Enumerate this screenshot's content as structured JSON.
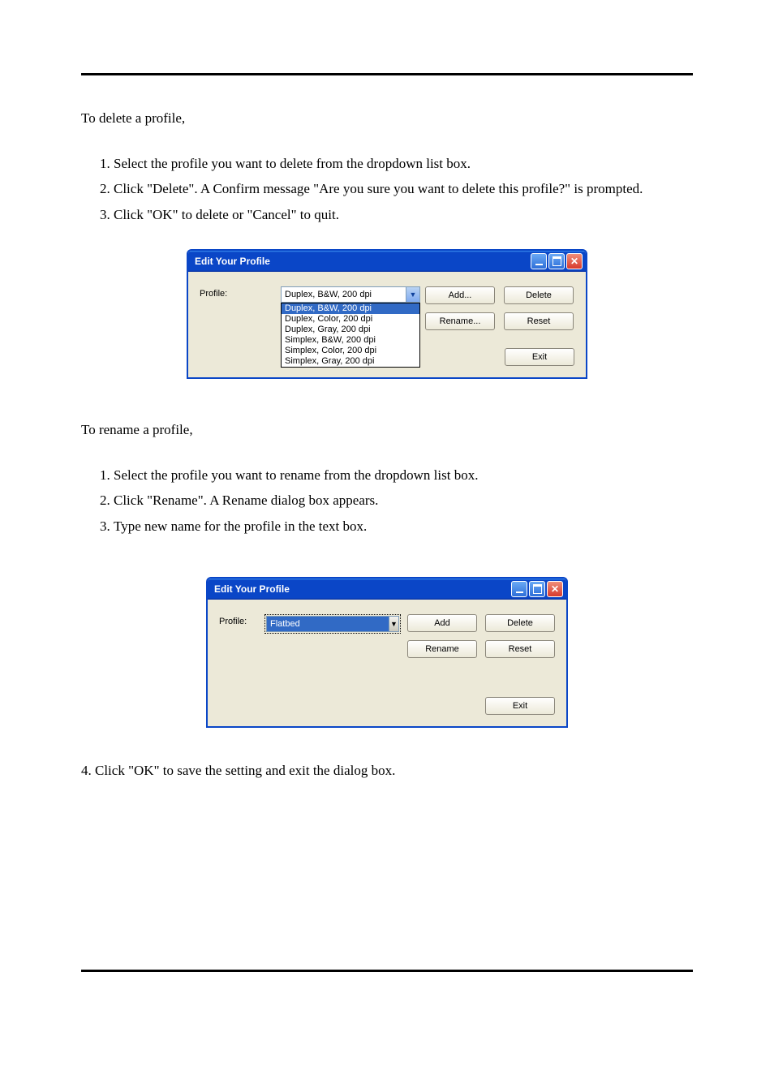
{
  "instructions": {
    "to_delete_a_profile": "To delete a profile,",
    "steps_delete": [
      "Select the profile you want to delete from the dropdown list box.",
      "Click \"Delete\". A Confirm message \"Are you sure you want to delete this profile?\" is prompted.",
      "Click \"OK\" to delete or \"Cancel\" to quit."
    ],
    "to_rename_a_profile": "To rename a profile,",
    "steps_rename": [
      "Select the profile you want to rename from the dropdown list box.",
      "Click \"Rename\". A Rename dialog box appears.",
      "Type new name for the profile in the text box."
    ],
    "click_ok_rename": "4. Click \"OK\" to save the setting and exit the dialog box."
  },
  "window": {
    "title": "Edit Your Profile",
    "profile_label": "Profile:",
    "buttons": {
      "add": "Add...",
      "delete": "Delete",
      "rename": "Rename...",
      "reset": "Reset",
      "exit": "Exit",
      "add_plain": "Add",
      "rename_plain": "Rename"
    }
  },
  "dropdown1": {
    "selected": "Duplex, B&W, 200 dpi",
    "options": [
      "Duplex, B&W, 200 dpi",
      "Duplex, Color, 200 dpi",
      "Duplex, Gray, 200 dpi",
      "Simplex, B&W, 200 dpi",
      "Simplex, Color, 200 dpi",
      "Simplex, Gray, 200 dpi"
    ]
  },
  "dropdown2": {
    "selected": "Flatbed"
  }
}
